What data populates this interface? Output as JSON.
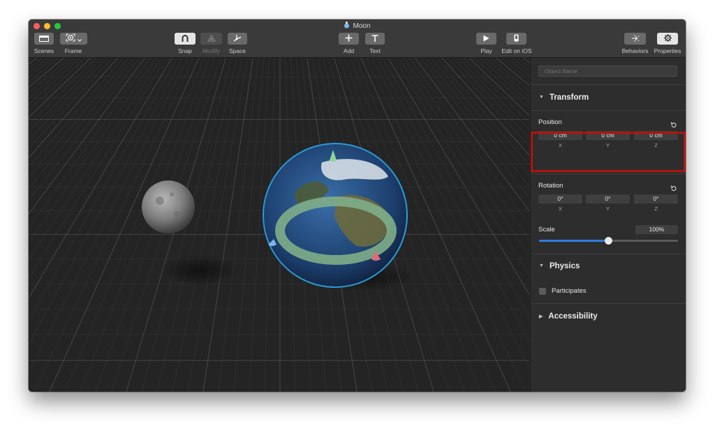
{
  "window": {
    "title": "Moon",
    "title_icon": "reality-file-icon"
  },
  "toolbar": {
    "scenes": "Scenes",
    "frame": "Frame",
    "snap": "Snap",
    "modify": "Modify",
    "space": "Space",
    "add": "Add",
    "text": "Text",
    "play": "Play",
    "edit_on_ios": "Edit on iOS",
    "behaviors": "Behaviors",
    "properties": "Properties"
  },
  "inspector": {
    "object_name_placeholder": "Object Name",
    "transform": {
      "title": "Transform",
      "position": {
        "label": "Position",
        "x": "0 cm",
        "y": "0 cm",
        "z": "0 cm",
        "x_label": "X",
        "y_label": "Y",
        "z_label": "Z"
      },
      "rotation": {
        "label": "Rotation",
        "x": "0°",
        "y": "0°",
        "z": "0°",
        "x_label": "X",
        "y_label": "Y",
        "z_label": "Z"
      },
      "scale": {
        "label": "Scale",
        "value": "100%",
        "slider_fraction": 0.5
      }
    },
    "physics": {
      "title": "Physics",
      "participates_label": "Participates",
      "participates_checked": false
    },
    "accessibility": {
      "title": "Accessibility"
    }
  },
  "colors": {
    "accent": "#2f7fe0",
    "highlight": "#b3140b",
    "gizmo_ring": "#7fae88",
    "selection_outline": "#2a9ad6"
  }
}
